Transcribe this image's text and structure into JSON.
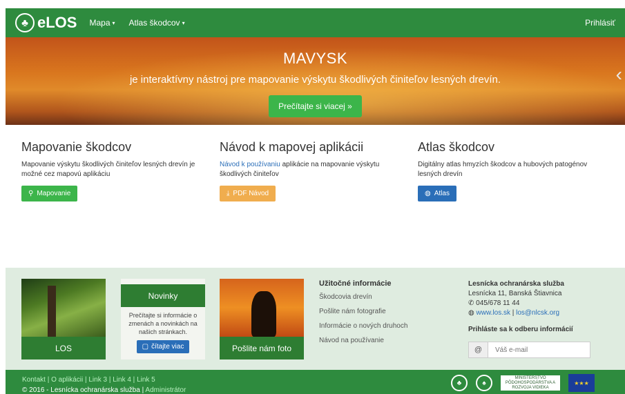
{
  "navbar": {
    "brand": "eLOS",
    "menu": [
      {
        "label": "Mapa"
      },
      {
        "label": "Atlas škodcov"
      }
    ],
    "login": "Prihlásiť"
  },
  "hero": {
    "title": "MAVYSK",
    "subtitle": "je interaktívny nástroj pre mapovanie výskytu škodlivých činiteľov lesných drevín.",
    "button": "Prečítajte si viacej »"
  },
  "features": [
    {
      "title": "Mapovanie škodcov",
      "text": "Mapovanie výskytu škodlivých činiteľov lesných drevín je možné cez mapovú aplikáciu",
      "button": "Mapovanie",
      "color": "#3cb54a"
    },
    {
      "title": "Návod k mapovej aplikácii",
      "link": "Návod k používaniu",
      "text": " aplikácie na mapovanie výskytu škodlivých činiteľov",
      "button": "PDF Návod",
      "color": "#f0ad4e"
    },
    {
      "title": "Atlas škodcov",
      "text": "Digitálny atlas hmyzích škodcov a hubových patogénov lesných drevín",
      "button": "Atlas",
      "color": "#2a6eb8"
    }
  ],
  "footer": {
    "tiles": {
      "los": "LOS",
      "photo": "Pošlite nám foto"
    },
    "news": {
      "title": "Novinky",
      "text": "Prečítajte si informácie o zmenách a novinkách na našich stránkach.",
      "button": "čítajte viac"
    },
    "useful": {
      "title": "Užitočné informácie",
      "links": [
        "Škodcovia drevín",
        "Pošlite nám fotografie",
        "Informácie o nových druhoch",
        "Návod na používanie"
      ]
    },
    "contact": {
      "org": "Lesnícka ochranárska služba",
      "address": "Lesnícka 11, Banská Štiavnica",
      "phone": "045/678 11 44",
      "web": "www.los.sk",
      "separator": " | ",
      "email": "los@nlcsk.org",
      "subscribe_title": "Prihláste sa k odberu informácií",
      "email_placeholder": "Váš e-mail",
      "at": "@"
    }
  },
  "bottom": {
    "links": [
      "Kontakt",
      "O aplikácii",
      "Link 3",
      "Link 4",
      "Link 5"
    ],
    "separator": " | ",
    "copyright": "© 2016 - Lesnícka ochranárska služba | ",
    "admin": "Administrátor",
    "ministry": "MINISTERSTVO PÔDOHOSPODÁRSTVA A ROZVOJA VIDIEKA"
  },
  "colors": {
    "primary_green": "#2e8b3e",
    "button_green": "#3cb54a",
    "button_orange": "#f0ad4e",
    "button_blue": "#2a6eb8",
    "footer_bg": "#dfece0"
  }
}
